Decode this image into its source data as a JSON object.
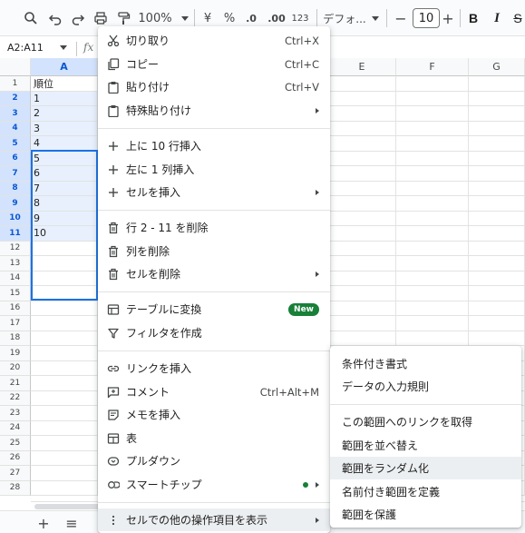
{
  "toolbar": {
    "zoom": "100%",
    "currency": "¥",
    "percent": "%",
    "decrease_decimals": ".0",
    "increase_decimals": ".00",
    "number_format": "123",
    "font": "デフォ...",
    "font_size": "10",
    "font_minus": "−",
    "font_plus": "+",
    "bold": "B",
    "italic": "I",
    "strike": "S"
  },
  "namebox": {
    "value": "A2:A11",
    "fx": "fx"
  },
  "columns": [
    "A",
    "E",
    "F",
    "G"
  ],
  "rows": [
    "1",
    "2",
    "3",
    "4",
    "5",
    "6",
    "7",
    "8",
    "9",
    "10",
    "11",
    "12",
    "13",
    "14",
    "15",
    "16",
    "17",
    "18",
    "19",
    "20",
    "21",
    "22",
    "23",
    "24",
    "25",
    "26",
    "27",
    "28"
  ],
  "cells_a": [
    "順位",
    "1",
    "2",
    "3",
    "4",
    "5",
    "6",
    "7",
    "8",
    "9",
    "10"
  ],
  "context_menu": {
    "items": [
      {
        "label": "切り取り",
        "shortcut": "Ctrl+X",
        "icon": "scissors-icon"
      },
      {
        "label": "コピー",
        "shortcut": "Ctrl+C",
        "icon": "copy-icon"
      },
      {
        "label": "貼り付け",
        "shortcut": "Ctrl+V",
        "icon": "clipboard-icon"
      },
      {
        "label": "特殊貼り付け",
        "icon": "clipboard-icon"
      },
      {
        "label": "上に 10 行挿入",
        "icon": "plus-icon"
      },
      {
        "label": "左に 1 列挿入",
        "icon": "plus-icon"
      },
      {
        "label": "セルを挿入",
        "icon": "plus-icon"
      },
      {
        "label": "行 2 - 11 を削除",
        "icon": "trash-icon"
      },
      {
        "label": "列を削除",
        "icon": "trash-icon"
      },
      {
        "label": "セルを削除",
        "icon": "trash-icon"
      },
      {
        "label": "テーブルに変換",
        "badge": "New",
        "icon": "table-icon"
      },
      {
        "label": "フィルタを作成",
        "icon": "filter-icon"
      },
      {
        "label": "リンクを挿入",
        "icon": "link-icon"
      },
      {
        "label": "コメント",
        "shortcut": "Ctrl+Alt+M",
        "icon": "comment-icon"
      },
      {
        "label": "メモを挿入",
        "icon": "note-icon"
      },
      {
        "label": "表",
        "icon": "table-icon"
      },
      {
        "label": "プルダウン",
        "icon": "dropdown-icon"
      },
      {
        "label": "スマートチップ",
        "icon": "smart-chip-icon"
      },
      {
        "label": "セルでの他の操作項目を表示",
        "icon": "more-vert-icon"
      }
    ]
  },
  "submenu": {
    "items": [
      {
        "label": "条件付き書式"
      },
      {
        "label": "データの入力規則"
      },
      {
        "label": "この範囲へのリンクを取得"
      },
      {
        "label": "範囲を並べ替え"
      },
      {
        "label": "範囲をランダム化"
      },
      {
        "label": "名前付き範囲を定義"
      },
      {
        "label": "範囲を保護"
      }
    ]
  },
  "sheetbar": {
    "add": "+",
    "list": "≡"
  }
}
